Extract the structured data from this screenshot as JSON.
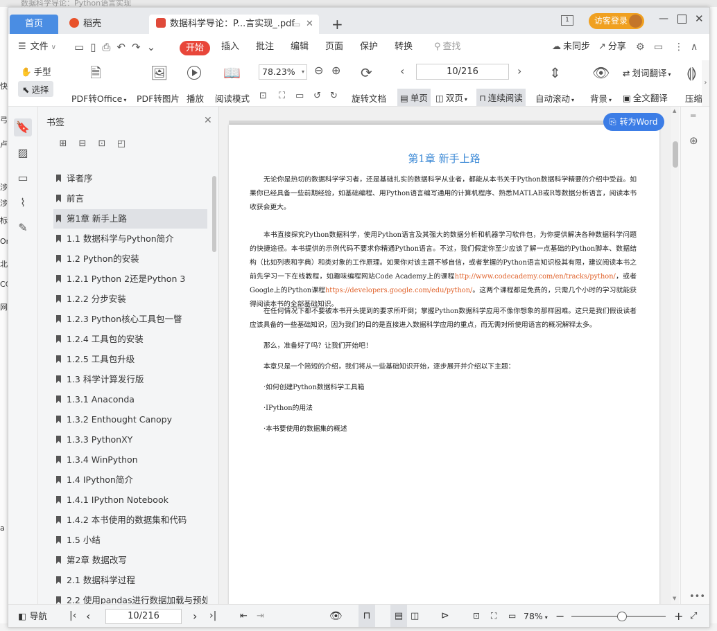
{
  "background_window": {
    "title": "数据科学导论：Python语言实现",
    "left_edge_chars": [
      "快",
      "弓",
      "卢",
      "涉",
      "涉",
      "标",
      "Or",
      "北",
      "CC",
      "网",
      "a"
    ]
  },
  "tabs": {
    "home": "首页",
    "daoke": "稻壳",
    "doc": "数据科学导论：P...言实现_.pdf",
    "new_tab": "+"
  },
  "titlebar": {
    "login": "访客登录",
    "page_count_icon": "1"
  },
  "menu": {
    "file": "文件",
    "items": [
      "开始",
      "插入",
      "批注",
      "编辑",
      "页面",
      "保护",
      "转换"
    ],
    "search": "查找",
    "sync": "未同步",
    "share": "分享"
  },
  "ribbon": {
    "hand": "手型",
    "select": "选择",
    "pdf_to_office": "PDF转Office",
    "pdf_to_image": "PDF转图片",
    "play": "播放",
    "read_mode": "阅读模式",
    "zoom": "78.23%",
    "page_input": "10/216",
    "rotate_doc": "旋转文档",
    "single_page": "单页",
    "double_page": "双页",
    "continuous": "连续阅读",
    "auto_scroll": "自动滚动",
    "background": "背景",
    "word_translate": "划词翻译",
    "full_translate": "全文翻译",
    "compress": "压缩"
  },
  "bookmarks": {
    "title": "书签",
    "items": [
      {
        "label": "译者序",
        "selected": false
      },
      {
        "label": "前言",
        "selected": false
      },
      {
        "label": "第1章   新手上路",
        "selected": true
      },
      {
        "label": "1.1    数据科学与Python简介",
        "selected": false
      },
      {
        "label": "1.2    Python的安装",
        "selected": false
      },
      {
        "label": "1.2.1    Python 2还是Python 3",
        "selected": false
      },
      {
        "label": "1.2.2    分步安装",
        "selected": false
      },
      {
        "label": "1.2.3    Python核心工具包一瞥",
        "selected": false
      },
      {
        "label": "1.2.4    工具包的安装",
        "selected": false
      },
      {
        "label": "1.2.5    工具包升级",
        "selected": false
      },
      {
        "label": "1.3    科学计算发行版",
        "selected": false
      },
      {
        "label": "1.3.1    Anaconda",
        "selected": false
      },
      {
        "label": "1.3.2    Enthought Canopy",
        "selected": false
      },
      {
        "label": "1.3.3    PythonXY",
        "selected": false
      },
      {
        "label": "1.3.4    WinPython",
        "selected": false
      },
      {
        "label": "1.4    IPython简介",
        "selected": false
      },
      {
        "label": "1.4.1    IPython Notebook",
        "selected": false
      },
      {
        "label": "1.4.2    本书使用的数据集和代码",
        "selected": false
      },
      {
        "label": "1.5    小结",
        "selected": false
      },
      {
        "label": "第2章   数据改写",
        "selected": false
      },
      {
        "label": "2.1    数据科学过程",
        "selected": false
      },
      {
        "label": "2.2    使用pandas进行数据加载与预处理",
        "selected": false
      }
    ]
  },
  "document": {
    "to_word": "转为Word",
    "chapter_title": "第1章    新手上路",
    "p1": "无论你是热切的数据科学学习者，还是基础扎实的数据科学从业者，都能从本书关于Python数据科学精要的介绍中受益。如果你已经具备一些前期经验，如基础编程、用Python语言编写通用的计算机程序、熟悉MATLAB或R等数据分析语言，阅读本书收获会更大。",
    "p2a": "本书直接探究Python数据科学，使用Python语言及其强大的数据分析和机器学习软件包，为你提供解决各种数据科学问题的快捷途径。本书提供的示例代码不要求你精通Python语言。不过，我们假定你至少应该了解一点基础的Python脚本、数据结构（比如列表和字典）和类对象的工作原理。如果你对该主题不够自信，或者掌握的Python语言知识极其有限，建议阅读本书之前先学习一下在线教程，如趣味编程网站Code Academy上的课程",
    "link1": "http://www.codecademy.com/en/tracks/python/",
    "p2b": "，或者Google上的Python课程",
    "link2": "https://developers.google.com/edu/python/",
    "p2c": "。这两个课程都是免费的，只需几个小时的学习就能获得阅读本书的全部基础知识。",
    "p3": "在任何情况下都不要被本书开头提到的要求所吓倒；掌握Python数据科学应用不像你想象的那样困难。这只是我们假设读者应该具备的一些基础知识，因为我们的目的是直接进入数据科学应用的重点，而无需对所使用语言的概况解释太多。",
    "p4": "那么，准备好了吗？让我们开始吧！",
    "p5": "本章只是一个简短的介绍，我们将从一些基础知识开始，逐步展开并介绍以下主题：",
    "bullets": [
      "·如何创建Python数据科学工具箱",
      "·IPython的用法",
      "·本书要使用的数据集的概述"
    ]
  },
  "statusbar": {
    "nav": "导航",
    "page": "10/216",
    "zoom": "78%",
    "zoom_level": 0.53
  }
}
